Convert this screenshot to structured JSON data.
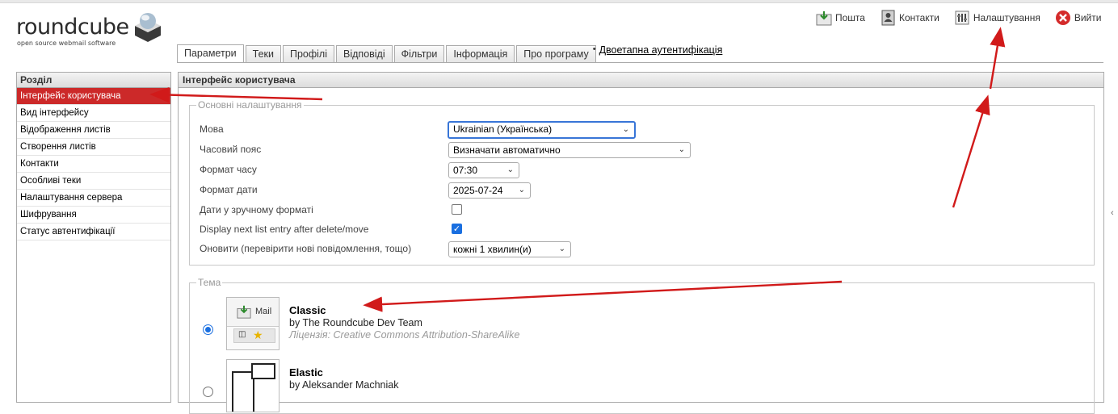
{
  "logo": {
    "name": "roundcube",
    "tagline": "open source webmail software"
  },
  "topnav": [
    {
      "label": "Пошта",
      "icon": "mail-icon"
    },
    {
      "label": "Контакти",
      "icon": "contacts-icon"
    },
    {
      "label": "Налаштування",
      "icon": "settings-icon"
    },
    {
      "label": "Вийти",
      "icon": "logout-icon"
    }
  ],
  "tabs": {
    "items": [
      "Параметри",
      "Теки",
      "Профілі",
      "Відповіді",
      "Фільтри",
      "Інформація",
      "Про програму"
    ],
    "active_index": 0,
    "extra_link": "Двоетапна аутентифікація"
  },
  "sidebar": {
    "header": "Розділ",
    "items": [
      "Інтерфейс користувача",
      "Вид інтерфейсу",
      "Відображення листів",
      "Створення листів",
      "Контакти",
      "Особливі теки",
      "Налаштування сервера",
      "Шифрування",
      "Статус автентифікації"
    ],
    "active_index": 0
  },
  "main": {
    "header": "Інтерфейс користувача",
    "basic": {
      "legend": "Основні налаштування",
      "language_label": "Мова",
      "language_value": "Ukrainian (Українська)",
      "timezone_label": "Часовий пояс",
      "timezone_value": "Визначати автоматично",
      "time_format_label": "Формат часу",
      "time_format_value": "07:30",
      "date_format_label": "Формат дати",
      "date_format_value": "2025-07-24",
      "pretty_dates_label": "Дати у зручному форматі",
      "pretty_dates_checked": false,
      "display_next_label": "Display next list entry after delete/move",
      "display_next_checked": true,
      "refresh_label": "Оновити (перевірити нові повідомлення, тощо)",
      "refresh_value": "кожні 1 хвилин(и)"
    },
    "theme": {
      "legend": "Тема",
      "skins": [
        {
          "name": "Classic",
          "author": "by The Roundcube Dev Team",
          "license": "Ліцензія: Creative Commons Attribution-ShareAlike",
          "selected": true,
          "thumb_label": "Mail"
        },
        {
          "name": "Elastic",
          "author": "by Aleksander Machniak",
          "license": "",
          "selected": false
        }
      ]
    }
  },
  "colors": {
    "accent": "#cc2929",
    "checkbox": "#1a6fe0",
    "annotation_arrow": "#d11a1a"
  }
}
